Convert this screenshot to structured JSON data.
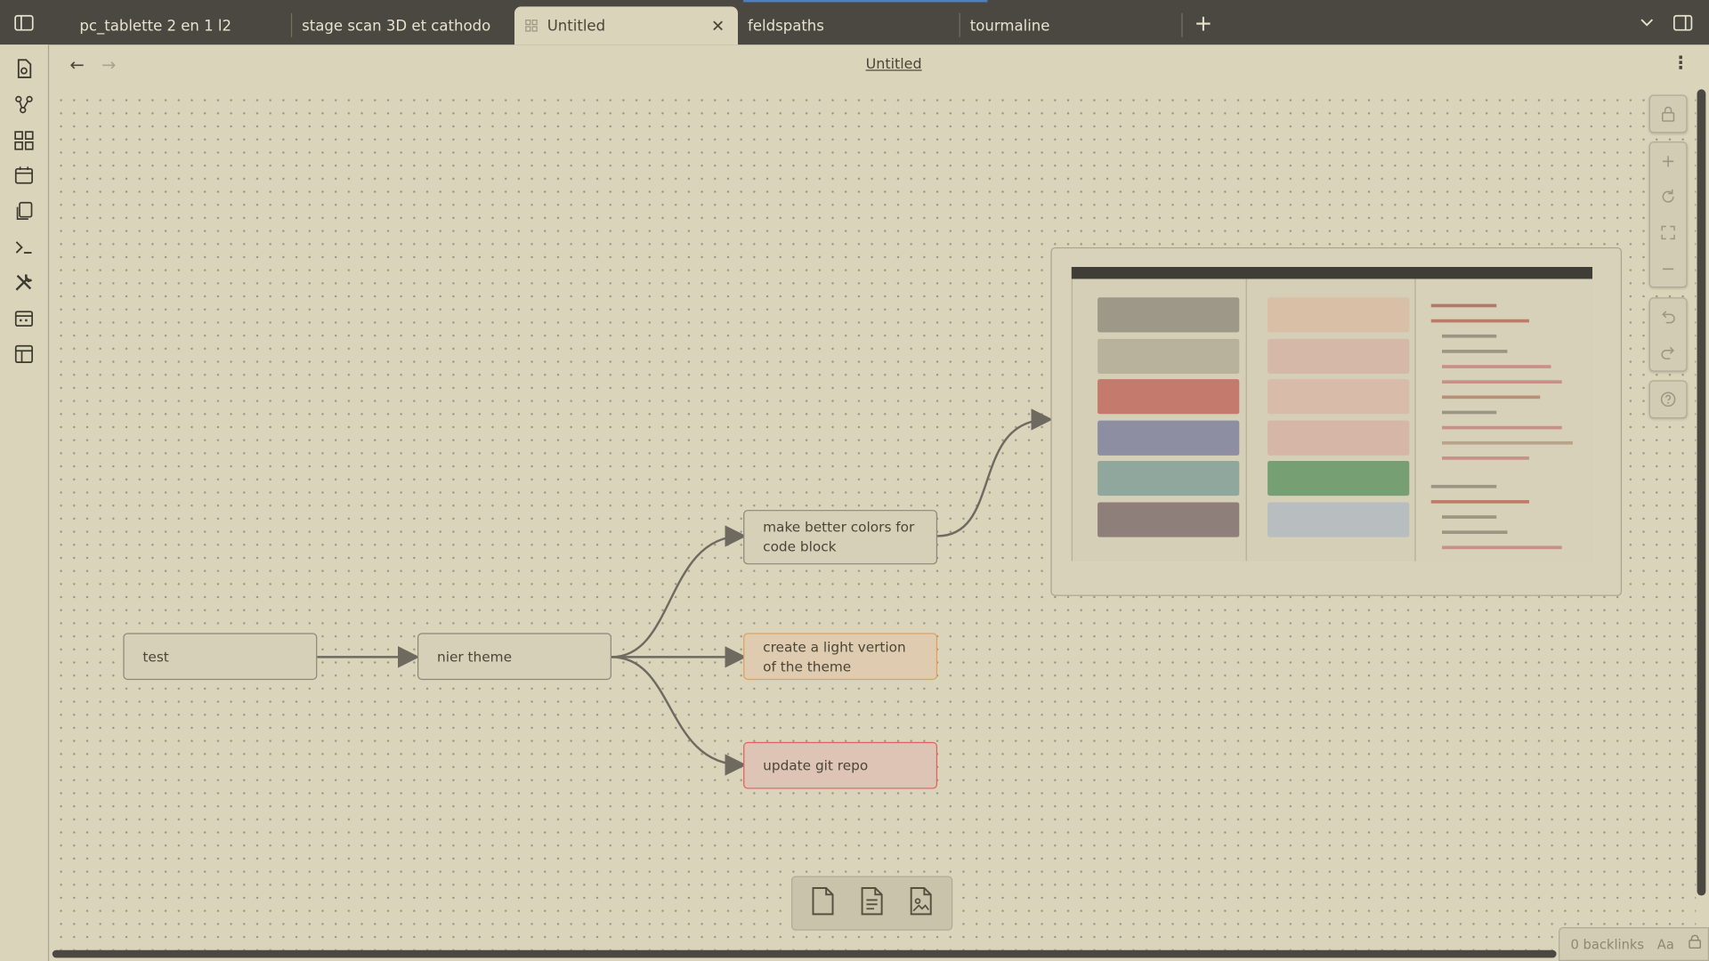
{
  "tabs": [
    {
      "label": "pc_tablette 2 en 1 l2",
      "active": false
    },
    {
      "label": "stage scan 3D et cathodo",
      "active": false
    },
    {
      "label": "Untitled",
      "active": true
    },
    {
      "label": "feldspaths",
      "active": false
    },
    {
      "label": "tourmaline",
      "active": false
    }
  ],
  "header": {
    "title": "Untitled"
  },
  "nodes": {
    "test": "test",
    "nier": "nier theme",
    "better": "make better colors for code block",
    "light": "create a light vertion of the theme",
    "git": "update git repo"
  },
  "status": {
    "backlinks": "0 backlinks",
    "font": "Aa"
  },
  "colors": {
    "background": "#dad4bb",
    "tabbar": "#4a4840",
    "node_border": "#8c877a",
    "orange_border": "#e0a060",
    "red_border": "#e06060",
    "edge": "#6e6a60"
  }
}
